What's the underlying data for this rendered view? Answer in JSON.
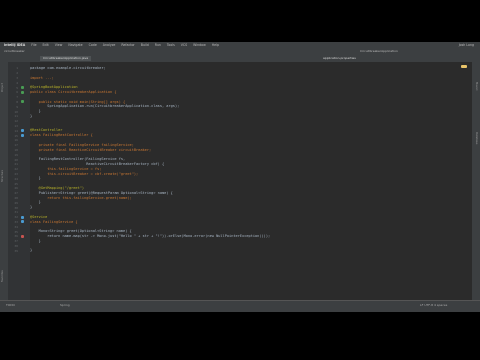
{
  "menu": {
    "app": "IntelliJ IDEA",
    "items": [
      "File",
      "Edit",
      "View",
      "Navigate",
      "Code",
      "Analyze",
      "Refactor",
      "Build",
      "Run",
      "Tools",
      "VCS",
      "Window",
      "Help"
    ],
    "right_status": "Josh Long"
  },
  "navbar": {
    "path": "circuitbreaker",
    "config": "CircuitbreakerApplication"
  },
  "tabs": [
    "CircuitbreakerApplication.java",
    "application.properties"
  ],
  "code_lines": [
    {
      "text": "package com.example.circuitbreaker;",
      "color": "#a9b7c6"
    },
    {
      "text": "",
      "color": "#a9b7c6"
    },
    {
      "text": "import ...;",
      "color": "#cc7832"
    },
    {
      "text": "",
      "color": "#a9b7c6"
    },
    {
      "text": "@SpringBootApplication",
      "color": "#bbb529"
    },
    {
      "text": "public class CircuitbreakerApplication {",
      "color": "#cc7832"
    },
    {
      "text": "",
      "color": "#a9b7c6"
    },
    {
      "text": "    public static void main(String[] args) {",
      "color": "#cc7832"
    },
    {
      "text": "        SpringApplication.run(CircuitbreakerApplication.class, args);",
      "color": "#a9b7c6"
    },
    {
      "text": "    }",
      "color": "#a9b7c6"
    },
    {
      "text": "}",
      "color": "#a9b7c6"
    },
    {
      "text": "",
      "color": "#a9b7c6"
    },
    {
      "text": "",
      "color": "#a9b7c6"
    },
    {
      "text": "@RestController",
      "color": "#bbb529"
    },
    {
      "text": "class FailingRestController {",
      "color": "#cc7832"
    },
    {
      "text": "",
      "color": "#a9b7c6"
    },
    {
      "text": "    private final FailingService failingService;",
      "color": "#cc7832"
    },
    {
      "text": "    private final ReactiveCircuitBreaker circuitBreaker;",
      "color": "#cc7832"
    },
    {
      "text": "",
      "color": "#a9b7c6"
    },
    {
      "text": "    FailingRestController(FailingService fs,",
      "color": "#a9b7c6"
    },
    {
      "text": "                          ReactiveCircuitBreakerFactory cbf) {",
      "color": "#a9b7c6"
    },
    {
      "text": "        this.failingService = fs;",
      "color": "#cc7832"
    },
    {
      "text": "        this.circuitBreaker = cbf.create(\"greet\");",
      "color": "#cc7832"
    },
    {
      "text": "    }",
      "color": "#a9b7c6"
    },
    {
      "text": "",
      "color": "#a9b7c6"
    },
    {
      "text": "    @GetMapping(\"/greet\")",
      "color": "#bbb529"
    },
    {
      "text": "    Publisher<String> greet(@RequestParam Optional<String> name) {",
      "color": "#a9b7c6"
    },
    {
      "text": "        return this.failingService.greet(name);",
      "color": "#cc7832"
    },
    {
      "text": "    }",
      "color": "#a9b7c6"
    },
    {
      "text": "}",
      "color": "#a9b7c6"
    },
    {
      "text": "",
      "color": "#a9b7c6"
    },
    {
      "text": "@Service",
      "color": "#bbb529"
    },
    {
      "text": "class FailingService {",
      "color": "#cc7832"
    },
    {
      "text": "",
      "color": "#a9b7c6"
    },
    {
      "text": "    Mono<String> greet(Optional<String> name) {",
      "color": "#a9b7c6"
    },
    {
      "text": "        return name.map(str -> Mono.just(\"Hello \" + str + \"!\")).orElse(Mono.error(new NullPointerException()));",
      "color": "#a9b7c6"
    },
    {
      "text": "    }",
      "color": "#a9b7c6"
    },
    {
      "text": "",
      "color": "#a9b7c6"
    },
    {
      "text": "}",
      "color": "#a9b7c6"
    }
  ],
  "status": {
    "left": "TODO",
    "middle": "Spring",
    "right": "LF  UTF-8  4 spaces"
  },
  "side_panels": {
    "project": "Project",
    "structure": "Structure",
    "favorites": "Favorites",
    "maven": "Maven",
    "database": "Database"
  }
}
